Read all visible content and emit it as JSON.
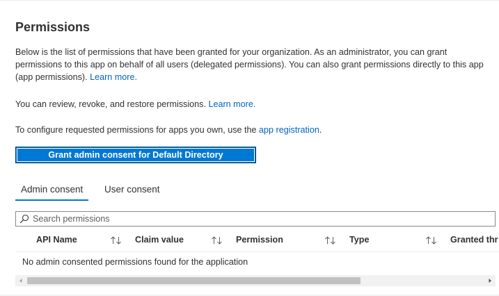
{
  "section": {
    "title": "Permissions",
    "paragraph1": {
      "line1": "Below is the list of permissions that have been granted for your organization. As an administrator, you can grant",
      "line2": "permissions to this app on behalf of all users (delegated permissions). You can also grant permissions directly to this app",
      "line3_text": "(app permissions). ",
      "line3_link": "Learn more."
    },
    "paragraph2": {
      "text": "You can review, revoke, and restore permissions. ",
      "link": "Learn more."
    },
    "paragraph3": {
      "text": "To configure requested permissions for apps you own, use the ",
      "link": "app registration",
      "suffix": "."
    }
  },
  "grant_button": {
    "label": "Grant admin consent for Default Directory"
  },
  "tabs": [
    {
      "label": "Admin consent",
      "active": true
    },
    {
      "label": "User consent",
      "active": false
    }
  ],
  "search": {
    "placeholder": "Search permissions",
    "value": ""
  },
  "table": {
    "columns": [
      {
        "label": "API Name"
      },
      {
        "label": "Claim value"
      },
      {
        "label": "Permission"
      },
      {
        "label": "Type"
      },
      {
        "label": "Granted thr"
      }
    ],
    "empty_message": "No admin consented permissions found for the application"
  },
  "scrollbar": {
    "thumb_fraction": 0.73
  },
  "colors": {
    "accent": "#0078d4",
    "link": "#0064bf",
    "text": "#323130"
  }
}
